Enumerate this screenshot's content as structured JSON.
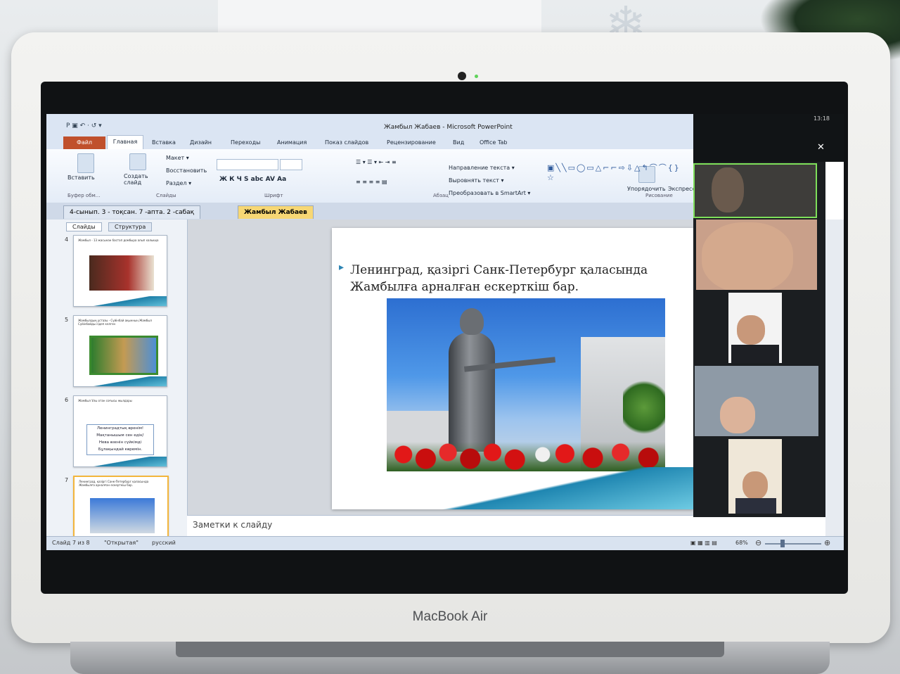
{
  "laptop": {
    "brand": "MacBook Air"
  },
  "app": {
    "title": "Жамбыл Жабаев - Microsoft PowerPoint",
    "quick_access": "P ▣ ↶ · ↺ ▾",
    "tabs": [
      "Главная",
      "Вставка",
      "Дизайн",
      "Переходы",
      "Анимация",
      "Показ слайдов",
      "Рецензирование",
      "Вид",
      "Office Tab"
    ],
    "file_tab": "Файл",
    "ribbon": {
      "paste": "Вставить",
      "create_slide": "Создать слайд",
      "layout": "Макет ▾",
      "restore": "Восстановить",
      "section": "Раздел ▾",
      "text_direction": "Направление текста ▾",
      "align_text": "Выровнять текст ▾",
      "smartart": "Преобразовать в SmartArt ▾",
      "arrange": "Упорядочить",
      "express": "Экспресс",
      "groups": {
        "clipboard": "Буфер обм...",
        "slides": "Слайды",
        "font": "Шрифт",
        "paragraph": "Абзац",
        "drawing": "Рисование"
      }
    },
    "doc_tabs": [
      "4-сынып. 3 - тоқсан. 7 -апта. 2 -сабақ",
      "Жамбыл Жабаев"
    ],
    "panel_tabs": [
      "Слайды",
      "Структура"
    ],
    "thumbnails": [
      {
        "num": "4",
        "lines": "Жамбыл - 13 жасынан бастап домбыра алып халыққа"
      },
      {
        "num": "5",
        "lines": "Жамбылдың ұстазы - Сүйінбай ақынның Жамбыл Сүйінбайды іздеп келген"
      },
      {
        "num": "6",
        "lines": "Жамбыл Ұлы отан соғысы жылдары",
        "poem": [
          "Ленинградтық өренім!",
          "Мақтанышым сен едің!",
          "Нева өзенін сүйкімді",
          "Бұлақындай көремін."
        ]
      },
      {
        "num": "7",
        "lines": "Ленинград, қазіргі Санк-Петербург қаласында Жамбылға арналған ескерткіш бар."
      }
    ],
    "slide": {
      "text": "Ленинград, қазіргі Санк-Петербург қаласында Жамбылға арналған ескерткіш бар."
    },
    "notes_placeholder": "Заметки к слайду",
    "status": {
      "slide": "Слайд 7 из 8",
      "theme": "\"Открытая\"",
      "language": "русский",
      "zoom": "68%"
    }
  },
  "zoom": {
    "time": "13:18"
  }
}
